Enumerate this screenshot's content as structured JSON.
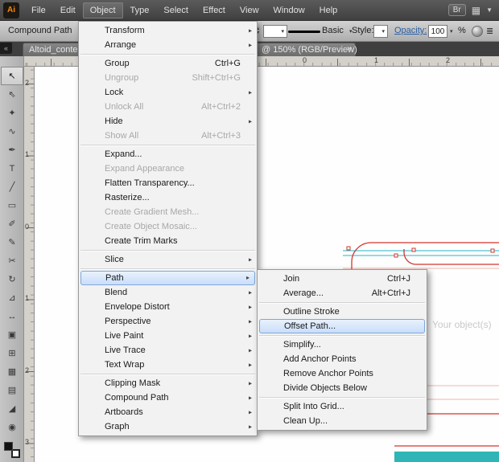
{
  "colors": {
    "menu_highlight_border": "#7da7d9",
    "artwork_red": "#d4352b",
    "artwork_cyan": "#27b6c9",
    "artwork_pink": "#f0b5ae",
    "artwork_teal": "#2fb5b5",
    "accent_blue": "#2b5fa3"
  },
  "icons": {
    "submenu_arrow": "▸",
    "dropdown": "▾",
    "menubar_dropdown": "▼",
    "workspace_grid": "▦",
    "collapse_left": "«",
    "panel_menu": "≣",
    "stepper_up": "▴",
    "stepper_down": "▾"
  },
  "menubar": {
    "logo": "Ai",
    "items": [
      "File",
      "Edit",
      "Object",
      "Type",
      "Select",
      "Effect",
      "View",
      "Window",
      "Help"
    ],
    "active_item": "Object",
    "bridge_label": "Br"
  },
  "controlbar": {
    "selection_label": "Compound Path",
    "stroke_style": "Basic",
    "style_label": "Style:",
    "opacity_label": "Opacity:",
    "opacity_value": "100",
    "percent_label": "%"
  },
  "tab": {
    "left_text": "Altoid_conte",
    "right_text": "@ 150% (RGB/Preview)",
    "close": "×"
  },
  "rulers": {
    "horizontal_numbers": [
      "0",
      "1",
      "2"
    ],
    "vertical_numbers": [
      "2",
      "1",
      "0",
      "1",
      "2",
      "3"
    ]
  },
  "toolbar": {
    "tools": [
      {
        "name": "selection-tool",
        "glyph": "↖",
        "selected": true
      },
      {
        "name": "direct-selection-tool",
        "glyph": "⇖"
      },
      {
        "name": "magic-wand-tool",
        "glyph": "✦"
      },
      {
        "name": "lasso-tool",
        "glyph": "∿"
      },
      {
        "name": "pen-tool",
        "glyph": "✒"
      },
      {
        "name": "type-tool",
        "glyph": "T"
      },
      {
        "name": "line-segment-tool",
        "glyph": "╱"
      },
      {
        "name": "rectangle-tool",
        "glyph": "▭"
      },
      {
        "name": "paintbrush-tool",
        "glyph": "✐"
      },
      {
        "name": "pencil-tool",
        "glyph": "✎"
      },
      {
        "name": "scissors-tool",
        "glyph": "✂"
      },
      {
        "name": "rotate-tool",
        "glyph": "↻"
      },
      {
        "name": "scale-tool",
        "glyph": "⊿"
      },
      {
        "name": "width-tool",
        "glyph": "↔"
      },
      {
        "name": "free-transform-tool",
        "glyph": "▣"
      },
      {
        "name": "perspective-grid-tool",
        "glyph": "⊞"
      },
      {
        "name": "mesh-tool",
        "glyph": "▦"
      },
      {
        "name": "gradient-tool",
        "glyph": "▤"
      },
      {
        "name": "eyedropper-tool",
        "glyph": "◢"
      },
      {
        "name": "zoom-tool",
        "glyph": "◉"
      }
    ]
  },
  "object_menu": {
    "items": [
      {
        "label": "Transform",
        "submenu": true
      },
      {
        "label": "Arrange",
        "submenu": true
      },
      {
        "sep": true
      },
      {
        "label": "Group",
        "shortcut": "Ctrl+G"
      },
      {
        "label": "Ungroup",
        "shortcut": "Shift+Ctrl+G",
        "disabled": true
      },
      {
        "label": "Lock",
        "submenu": true
      },
      {
        "label": "Unlock All",
        "shortcut": "Alt+Ctrl+2",
        "disabled": true
      },
      {
        "label": "Hide",
        "submenu": true
      },
      {
        "label": "Show All",
        "shortcut": "Alt+Ctrl+3",
        "disabled": true
      },
      {
        "sep": true
      },
      {
        "label": "Expand..."
      },
      {
        "label": "Expand Appearance",
        "disabled": true
      },
      {
        "label": "Flatten Transparency..."
      },
      {
        "label": "Rasterize..."
      },
      {
        "label": "Create Gradient Mesh...",
        "disabled": true
      },
      {
        "label": "Create Object Mosaic...",
        "disabled": true
      },
      {
        "label": "Create Trim Marks"
      },
      {
        "sep": true
      },
      {
        "label": "Slice",
        "submenu": true
      },
      {
        "sep": true
      },
      {
        "label": "Path",
        "submenu": true,
        "highlighted": true
      },
      {
        "label": "Blend",
        "submenu": true
      },
      {
        "label": "Envelope Distort",
        "submenu": true
      },
      {
        "label": "Perspective",
        "submenu": true
      },
      {
        "label": "Live Paint",
        "submenu": true
      },
      {
        "label": "Live Trace",
        "submenu": true
      },
      {
        "label": "Text Wrap",
        "submenu": true
      },
      {
        "sep": true
      },
      {
        "label": "Clipping Mask",
        "submenu": true
      },
      {
        "label": "Compound Path",
        "submenu": true
      },
      {
        "label": "Artboards",
        "submenu": true
      },
      {
        "label": "Graph",
        "submenu": true
      }
    ]
  },
  "path_submenu": {
    "items": [
      {
        "label": "Join",
        "shortcut": "Ctrl+J"
      },
      {
        "label": "Average...",
        "shortcut": "Alt+Ctrl+J"
      },
      {
        "sep": true
      },
      {
        "label": "Outline Stroke"
      },
      {
        "label": "Offset Path...",
        "highlighted": true
      },
      {
        "sep": true
      },
      {
        "label": "Simplify..."
      },
      {
        "label": "Add Anchor Points"
      },
      {
        "label": "Remove Anchor Points"
      },
      {
        "label": "Divide Objects Below"
      },
      {
        "sep": true
      },
      {
        "label": "Split Into Grid..."
      },
      {
        "label": "Clean Up..."
      }
    ]
  },
  "canvas": {
    "hint_text": "Your object(s)"
  }
}
